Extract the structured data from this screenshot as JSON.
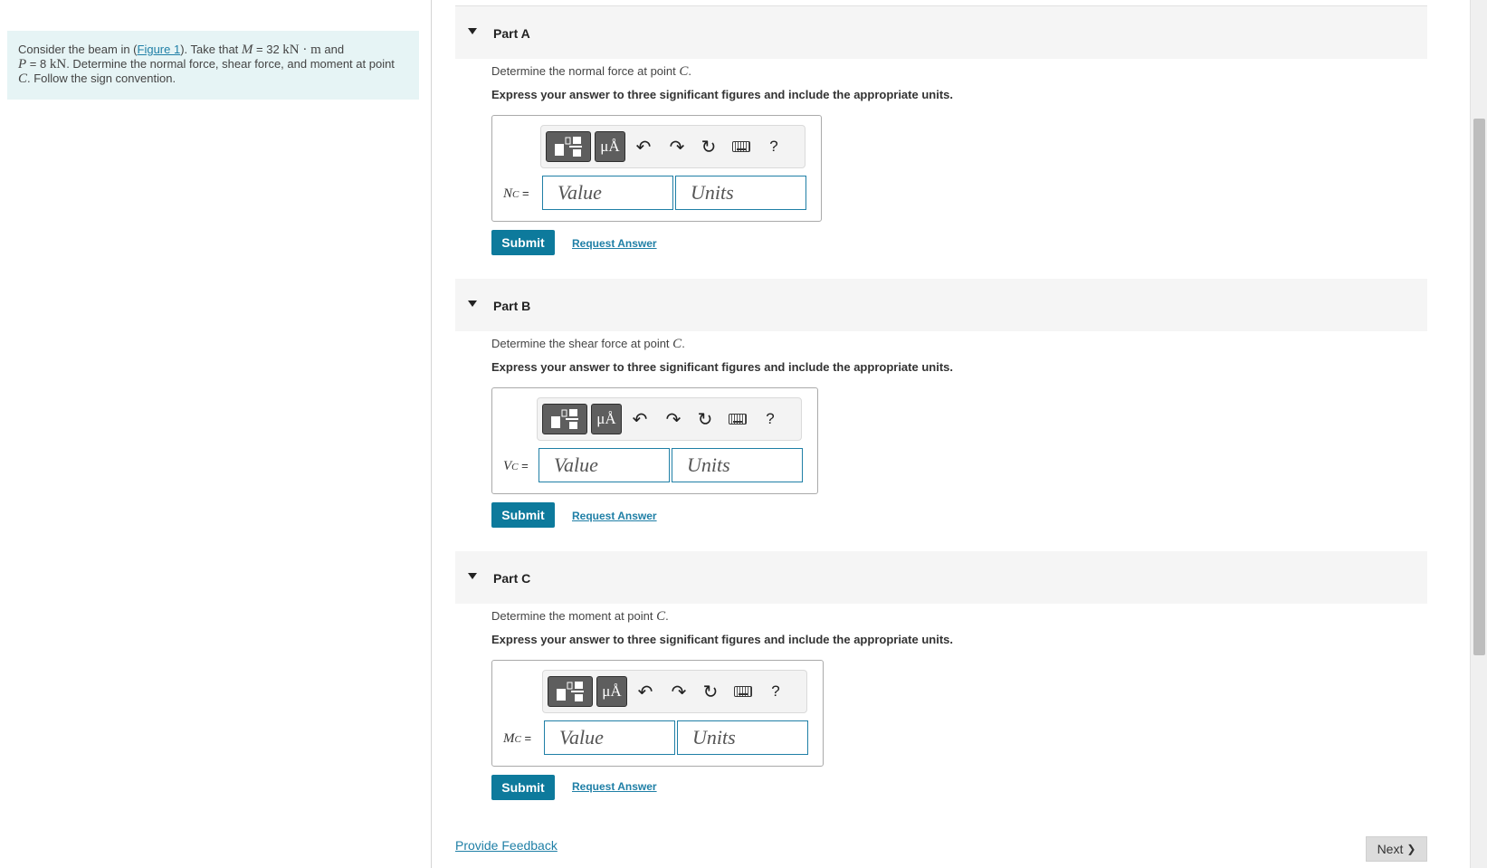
{
  "problem": {
    "text_before_link": "Consider the beam in (",
    "link_label": "Figure 1",
    "text_after_link": "). Take that ",
    "M_symbol": "M",
    "M_eq": " = 32 ",
    "M_unit": "kN · m",
    "and": " and",
    "P_symbol": "P",
    "P_eq": " = 8 ",
    "P_unit": "kN",
    "text_mid": ". Determine the normal force, shear force, and moment at point ",
    "point": "C",
    "text_end": ". Follow the sign convention."
  },
  "toolbar": {
    "units_label": "μÅ",
    "icons": [
      "templates-icon",
      "units-icon",
      "undo-icon",
      "redo-icon",
      "reset-icon",
      "keyboard-icon",
      "help-icon"
    ],
    "undo_glyph": "↶",
    "redo_glyph": "↷",
    "reset_glyph": "↻",
    "help_glyph": "?"
  },
  "parts": [
    {
      "title": "Part A",
      "question_prefix": "Determine the normal force at point ",
      "point": "C",
      "question_suffix": ".",
      "instruction": "Express your answer to three significant figures and include the appropriate units.",
      "var": "N",
      "sub": "C",
      "eq": " =",
      "value_placeholder": "Value",
      "units_placeholder": "Units",
      "submit": "Submit",
      "request": "Request Answer"
    },
    {
      "title": "Part B",
      "question_prefix": "Determine the shear force at point ",
      "point": "C",
      "question_suffix": ".",
      "instruction": "Express your answer to three significant figures and include the appropriate units.",
      "var": "V",
      "sub": "C",
      "eq": " =",
      "value_placeholder": "Value",
      "units_placeholder": "Units",
      "submit": "Submit",
      "request": "Request Answer"
    },
    {
      "title": "Part C",
      "question_prefix": "Determine the moment at point ",
      "point": "C",
      "question_suffix": ".",
      "instruction": "Express your answer to three significant figures and include the appropriate units.",
      "var": "M",
      "sub": "C",
      "eq": " =",
      "value_placeholder": "Value",
      "units_placeholder": "Units",
      "submit": "Submit",
      "request": "Request Answer"
    }
  ],
  "footer": {
    "feedback": "Provide Feedback",
    "next": "Next",
    "next_glyph": "❯"
  },
  "colors": {
    "accent": "#0d7a9c",
    "link": "#1f7fa6",
    "problem_bg": "#e6f4f5",
    "part_header_bg": "#f5f5f5"
  }
}
